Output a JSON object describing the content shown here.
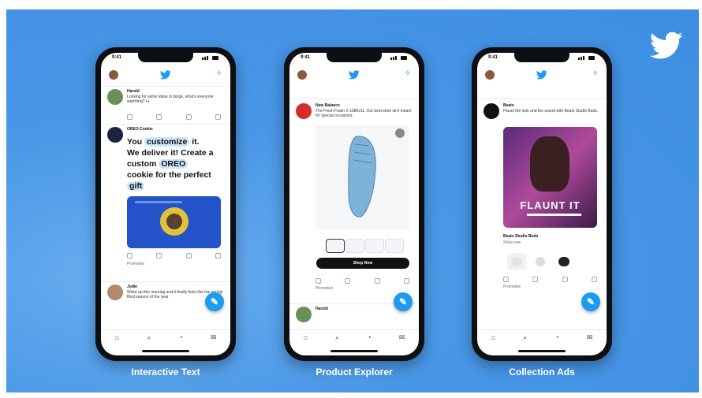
{
  "colors": {
    "background": "#3d8ee3",
    "accent": "#1d9bf0"
  },
  "brand_icon": "twitter-bird-icon",
  "phones": [
    {
      "caption": "Interactive Text",
      "status_time": "9:41",
      "tweets": {
        "t1_name": "Harold",
        "t1_text": "Looking for some ideas to binge, what's everyone watching? 👀",
        "t2_name": "OREO Cookie",
        "promo_line1": "You",
        "promo_pill1": "customize",
        "promo_line1b": "it.",
        "promo_line2": "We deliver it! Create a",
        "promo_line3a": "custom",
        "promo_pill2": "OREO",
        "promo_line4": "cookie for the perfect",
        "promo_pill3": "gift",
        "promoted": "Promoted",
        "t3_name": "Jodie",
        "t3_text": "Woke up this morning and it finally feels like the spring! Best season of the year"
      }
    },
    {
      "caption": "Product Explorer",
      "status_time": "9:41",
      "tweets": {
        "t1_name": "New Balance",
        "t1_text": "The Fresh Foam X 1080v11. Our best shoe isn't meant for special occasions.",
        "shop_now": "Shop Now",
        "promoted": "Promoted",
        "t2_name": "Harold"
      }
    },
    {
      "caption": "Collection Ads",
      "status_time": "9:41",
      "tweets": {
        "t1_name": "Beats",
        "t1_text": "Flaunt the look and the sound with Beats Studio Buds.",
        "hero_text": "FLAUNT IT",
        "product_title": "Beats Studio Buds",
        "product_sub": "Shop now",
        "promoted": "Promoted"
      }
    }
  ]
}
